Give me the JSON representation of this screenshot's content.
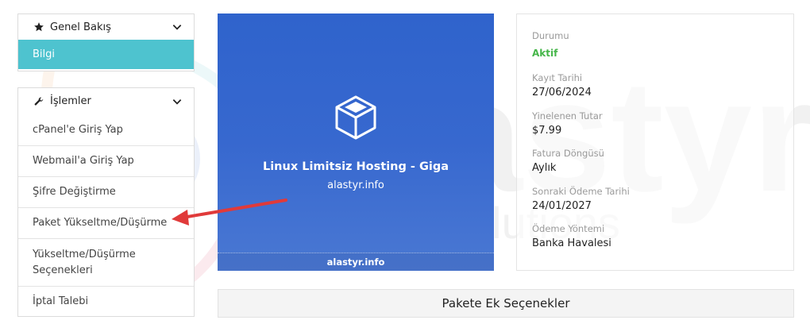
{
  "watermark": {
    "brand": "alastyr",
    "tagline": "solutions"
  },
  "overview": {
    "title": "Genel Bakış",
    "active_item": "Bilgi"
  },
  "actions": {
    "title": "İşlemler",
    "items": [
      "cPanel'e Giriş Yap",
      "Webmail'a Giriş Yap",
      "Şifre Değiştirme",
      "Paket Yükseltme/Düşürme",
      "Yükseltme/Düşürme Seçenekleri",
      "İptal Talebi"
    ]
  },
  "product": {
    "name": "Linux Limitsiz Hosting - Giga",
    "domain": "alastyr.info",
    "footer_domain": "alastyr.info"
  },
  "details": {
    "status_label": "Durumu",
    "status_value": "Aktif",
    "registration_label": "Kayıt Tarihi",
    "registration_value": "27/06/2024",
    "recurring_label": "Yinelenen Tutar",
    "recurring_value": "$7.99",
    "cycle_label": "Fatura Döngüsü",
    "cycle_value": "Aylık",
    "next_due_label": "Sonraki Ödeme Tarihi",
    "next_due_value": "24/01/2027",
    "payment_label": "Ödeme Yöntemi",
    "payment_value": "Banka Havalesi"
  },
  "addons": {
    "title": "Pakete Ek Seçenekler"
  },
  "colors": {
    "accent": "#4ec3cf",
    "card_blue": "#3266cd",
    "status_green": "#45b649",
    "arrow_red": "#e03a3a"
  }
}
